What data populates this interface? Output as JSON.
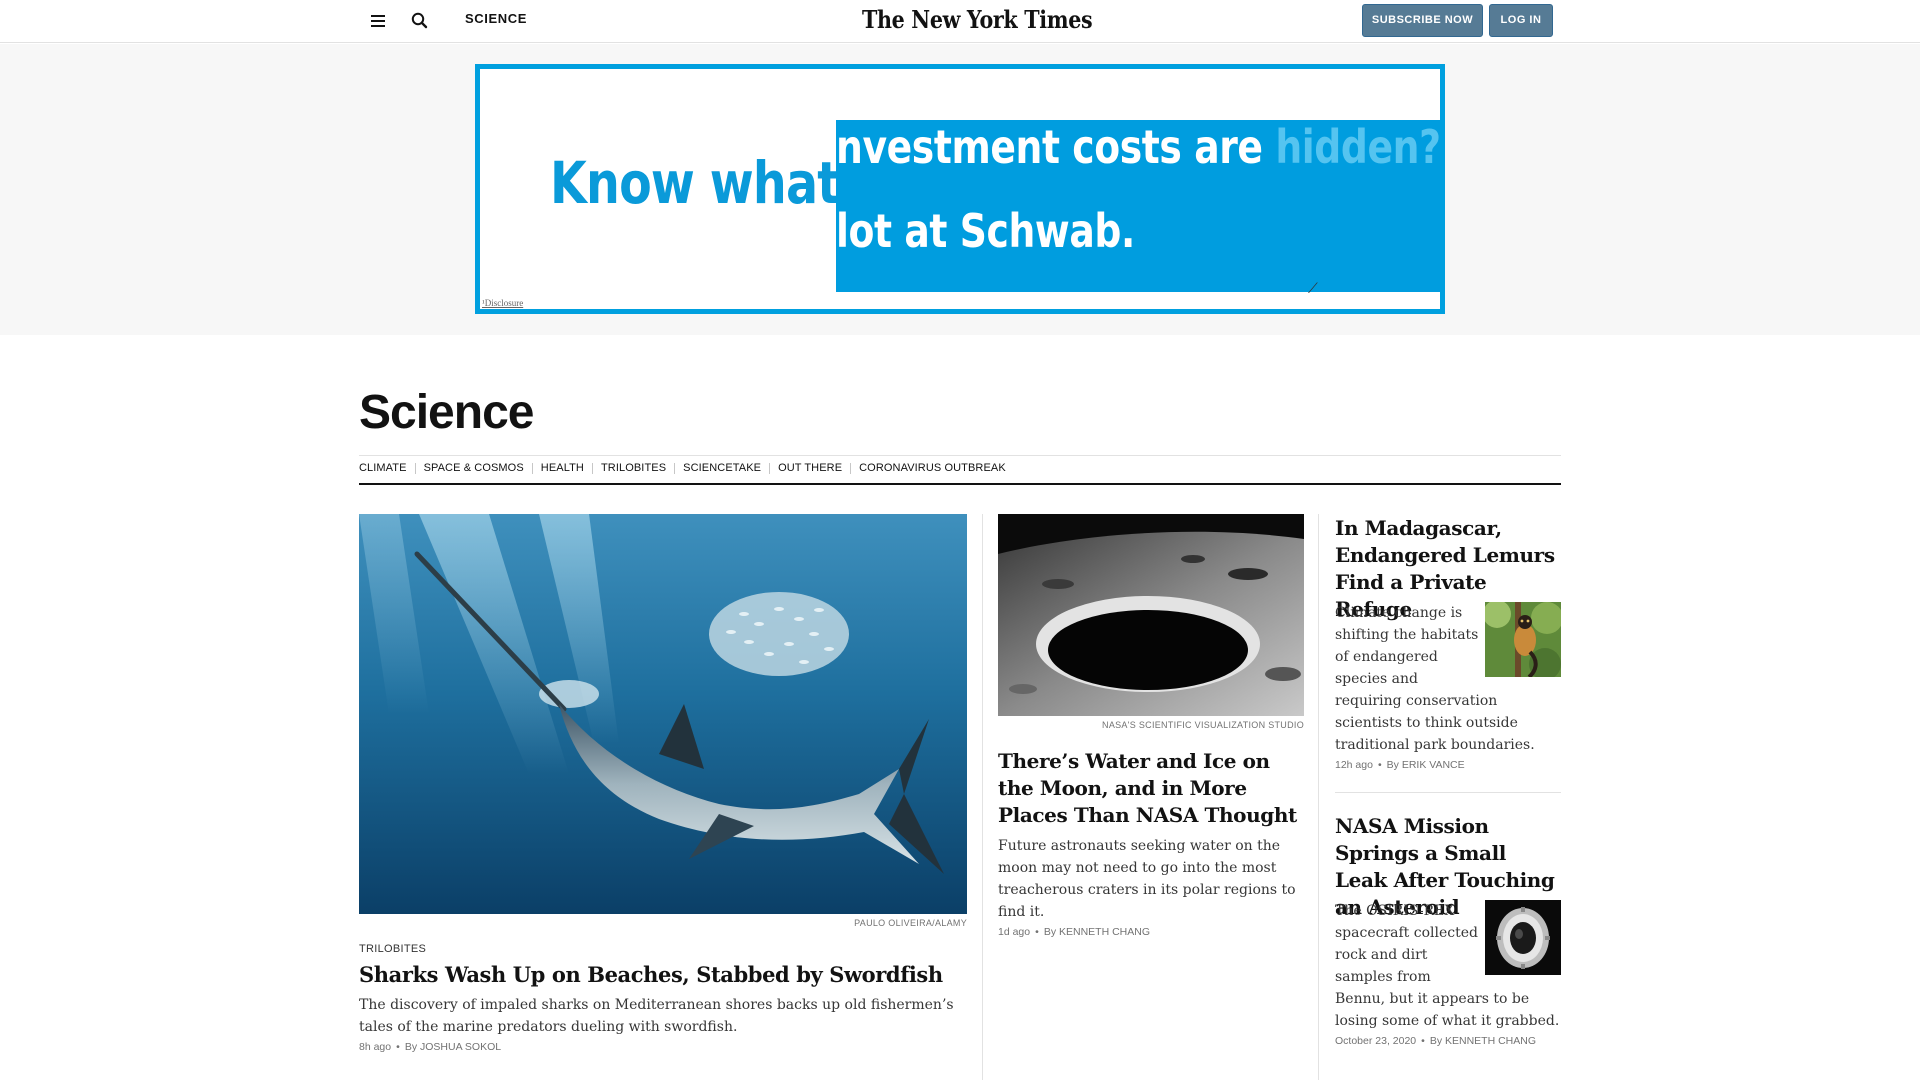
{
  "topbar": {
    "section": "SCIENCE",
    "logo": "The New York Times",
    "subscribe_label": "SUBSCRIBE NOW",
    "login_label": "LOG IN"
  },
  "ad": {
    "line1": "Know what y",
    "line2_main": "nvestment costs are ",
    "line2_faded": "hidden?",
    "line3": "lot at Schwab.",
    "disclosure": "¹Disclosure",
    "brand_color": "#00a0df"
  },
  "section": {
    "title": "Science",
    "subnav": [
      "CLIMATE",
      "SPACE & COSMOS",
      "HEALTH",
      "TRILOBITES",
      "SCIENCETAKE",
      "OUT THERE",
      "CORONAVIRUS OUTBREAK"
    ]
  },
  "stories": {
    "lead": {
      "credit": "PAULO OLIVEIRA/ALAMY",
      "kicker": "TRILOBITES",
      "headline": "Sharks Wash Up on Beaches, Stabbed by Swordfish",
      "summary": "The discovery of impaled sharks on Mediterranean shores backs up old fishermen’s tales of the marine predators dueling with swordfish.",
      "time": "8h ago",
      "byline": "By JOSHUA SOKOL"
    },
    "middle": {
      "credit": "NASA'S SCIENTIFIC VISUALIZATION STUDIO",
      "headline": "There’s Water and Ice on the Moon, and in More Places Than NASA Thought",
      "summary": "Future astronauts seeking water on the moon may not need to go into the most treacherous craters in its polar regions to find it.",
      "time": "1d ago",
      "byline": "By KENNETH CHANG"
    },
    "right1": {
      "headline": "In Madagascar, Endangered Lemurs Find a Private Refuge",
      "summary": "Climate change is shifting the habitats of endangered species and requiring conservation scientists to think outside traditional park boundaries.",
      "time": "12h ago",
      "byline": "By ERIK VANCE"
    },
    "right2": {
      "headline": "NASA Mission Springs a Small Leak After Touching an Asteroid",
      "summary": "The OSIRIS-REX spacecraft collected rock and dirt samples from Bennu, but it appears to be losing some of what it grabbed.",
      "time": "October 23, 2020",
      "byline": "By KENNETH CHANG"
    }
  }
}
